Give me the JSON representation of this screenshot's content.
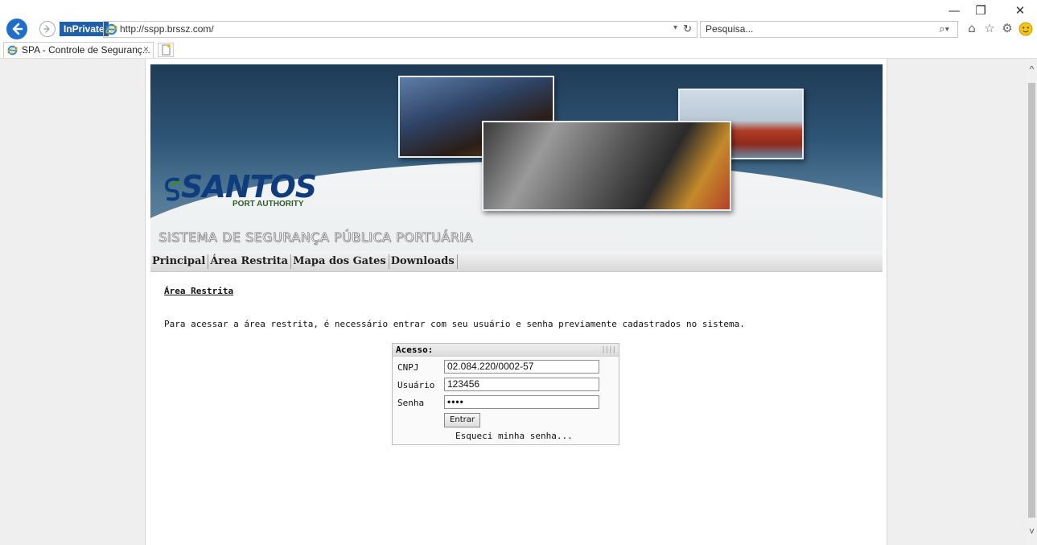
{
  "window": {
    "minimize_glyph": "—",
    "restore_glyph": "❐",
    "close_glyph": "✕"
  },
  "toolbar": {
    "inprivate_label": "InPrivate",
    "address": "http://sspp.brssz.com/",
    "search_placeholder": "Pesquisa...",
    "icons": [
      "back-icon",
      "forward-icon",
      "ie-logo-icon",
      "refresh-icon",
      "search-icon",
      "home-icon",
      "favorites-star-icon",
      "settings-gear-icon",
      "feedback-smiley-icon"
    ]
  },
  "tabs": [
    {
      "title": "SPA - Controle de Seguranç...",
      "close": "×"
    }
  ],
  "banner": {
    "logo_text": "SANTOS",
    "logo_sub": "PORT AUTHORITY",
    "system_title": "SISTEMA DE SEGURANÇA PÚBLICA PORTUÁRIA"
  },
  "nav": {
    "items": [
      "Principal",
      "Área Restrita",
      "Mapa dos Gates",
      "Downloads"
    ]
  },
  "content": {
    "title": "Área Restrita",
    "description": "Para acessar a área restrita, é necessário entrar com seu usuário e senha previamente cadastrados no sistema."
  },
  "login": {
    "header": "Acesso:",
    "grip": "||||",
    "cnpj_label": "CNPJ",
    "cnpj_value": "02.084.220/0002-57",
    "user_label": "Usuário",
    "user_value": "123456",
    "password_label": "Senha",
    "password_value": "••••",
    "submit_label": "Entrar",
    "forgot_label": "Esqueci minha senha..."
  },
  "colors": {
    "accent": "#1e6fc9",
    "inprivate": "#1f5fa8",
    "logo_blue": "#0f3c7d",
    "logo_green": "#2f5e2a"
  }
}
